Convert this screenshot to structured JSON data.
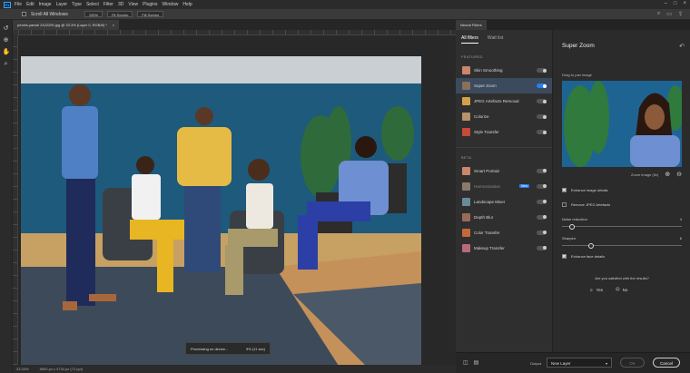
{
  "menubar": {
    "logo": "Ps",
    "items": [
      "File",
      "Edit",
      "Image",
      "Layer",
      "Type",
      "Select",
      "Filter",
      "3D",
      "View",
      "Plugins",
      "Window",
      "Help"
    ]
  },
  "options": {
    "scroll_all": "Scroll All Windows",
    "zoom": "100%",
    "fit_screen": "Fit Screen",
    "fill_screen": "Fill Screen"
  },
  "document": {
    "tab_title": "pexels-yanwli 2422290.jpg @ 33.3% (Layer 0, RGB/8) *",
    "tab_close": "×",
    "zoom_status": "33.33%",
    "doc_info": "5600 px x 3734 px (72 ppi)"
  },
  "toast": {
    "label": "Processing on device...",
    "progress": "9% (11 sec)"
  },
  "neural_filters": {
    "panel_title": "Neural Filters",
    "tabs": {
      "all": "All filters",
      "wait": "Wait list"
    },
    "featured_label": "FEATURED",
    "featured": [
      {
        "label": "Skin Smoothing",
        "icon_color": "#c9876b",
        "on": false
      },
      {
        "label": "Super Zoom",
        "icon_color": "#8a6f5a",
        "on": true
      },
      {
        "label": "JPEG Artefacts Removal",
        "icon_color": "#d2a24a",
        "on": false
      },
      {
        "label": "Colorize",
        "icon_color": "#b8926a",
        "on": false
      },
      {
        "label": "Style Transfer",
        "icon_color": "#c44a3a",
        "on": false
      }
    ],
    "beta_label": "BETA",
    "beta": [
      {
        "label": "Smart Portrait",
        "icon_color": "#c9876b",
        "on": false
      },
      {
        "label": "Harmonization",
        "icon_color": "#8a7a6a",
        "on": false,
        "badge": "New"
      },
      {
        "label": "Landscape Mixer",
        "icon_color": "#6a8a9a",
        "on": false
      },
      {
        "label": "Depth Blur",
        "icon_color": "#9a6a5a",
        "on": false
      },
      {
        "label": "Color Transfer",
        "icon_color": "#c46a3a",
        "on": false
      },
      {
        "label": "Makeup Transfer",
        "icon_color": "#b86a7a",
        "on": false
      }
    ],
    "detail": {
      "title": "Super Zoom",
      "drag_label": "Drag to pan image",
      "zoom_label": "Zoom image (5x)",
      "enhance_details": "Enhance image details",
      "remove_jpeg": "Remove JPEG Artefacts",
      "noise_label": "Noise reduction",
      "noise_value": "4",
      "noise_level": 0.08,
      "sharpen_label": "Sharpen",
      "sharpen_value": "6",
      "sharpen_level": 0.24,
      "enhance_face": "Enhance face details",
      "question": "Are you satisfied with the results?",
      "yes": "Yes",
      "no": "No"
    },
    "output_label": "Output",
    "output_value": "New Layer",
    "ok": "OK",
    "cancel": "Cancel"
  }
}
